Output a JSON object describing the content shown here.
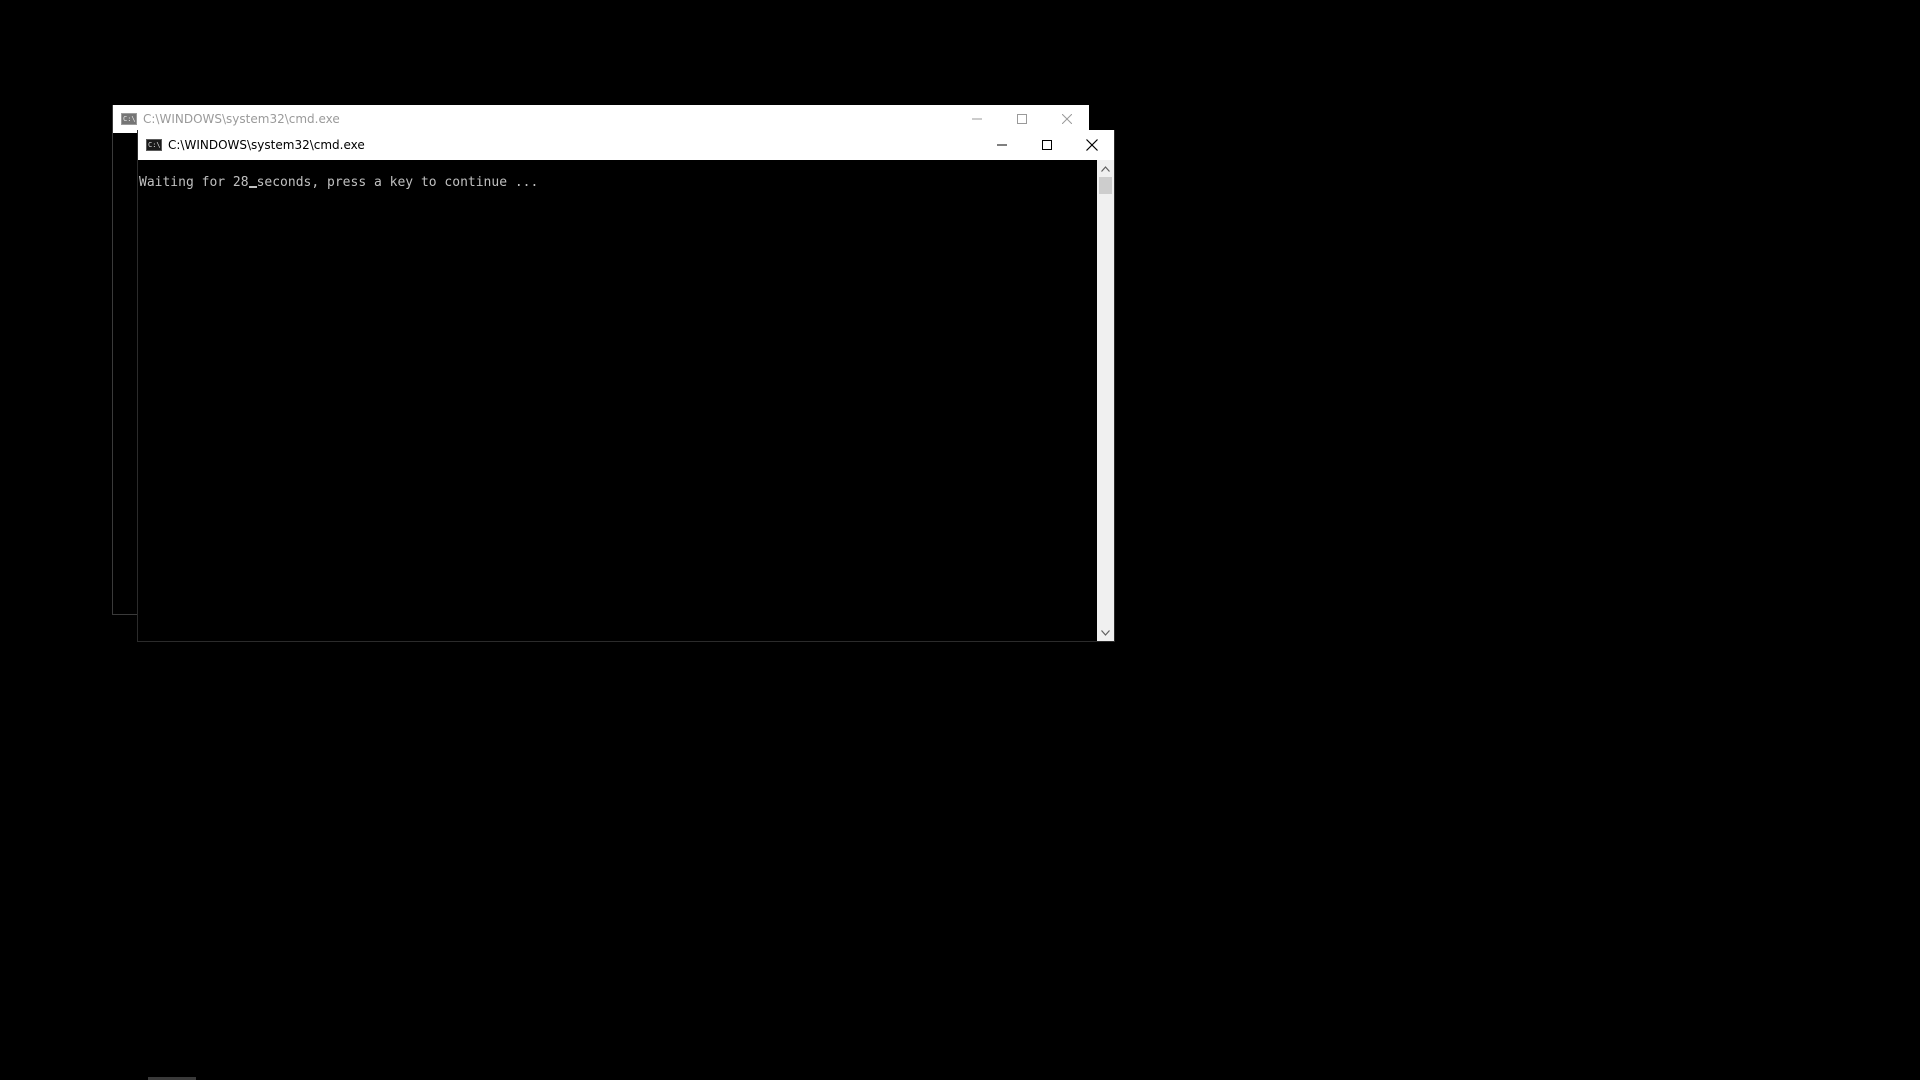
{
  "windows": {
    "back": {
      "title": "C:\\WINDOWS\\system32\\cmd.exe",
      "icon": "cmd-icon"
    },
    "front": {
      "title": "C:\\WINDOWS\\system32\\cmd.exe",
      "icon": "cmd-icon",
      "console": {
        "line_before_cursor": "Waiting for 28",
        "line_after_cursor": "seconds, press a key to continue ..."
      }
    }
  },
  "icons": {
    "minimize": "minimize-icon",
    "maximize": "maximize-icon",
    "close": "close-icon",
    "scroll_up": "chevron-up-icon",
    "scroll_down": "chevron-down-icon"
  },
  "colors": {
    "desktop": "#000000",
    "titlebar_active": "#ffffff",
    "titlebar_inactive_text": "#9a9a9a",
    "console_text": "#c0c0c0",
    "scrollbar": "#f0f0f0"
  }
}
